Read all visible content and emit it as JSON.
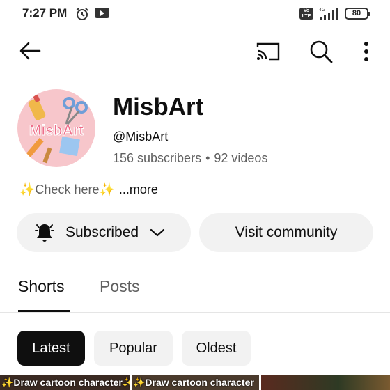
{
  "status_bar": {
    "time": "7:27 PM",
    "network": "4G",
    "volte": "Vo LTE",
    "battery": "80",
    "icons": [
      "alarm-icon",
      "youtube-notification-icon",
      "volte-icon",
      "signal-icon",
      "battery-icon"
    ]
  },
  "top_bar": {
    "icons": [
      "back-arrow-icon",
      "cast-icon",
      "search-icon",
      "more-vert-icon"
    ]
  },
  "channel": {
    "name": "MisbArt",
    "handle": "@MisbArt",
    "subscribers": "156 subscribers",
    "separator": "•",
    "videos": "92 videos",
    "avatar_text": "MisbArt",
    "description": {
      "sparkle": "✨",
      "text": "Check here",
      "more": "...more"
    }
  },
  "actions": {
    "subscribe_label": "Subscribed",
    "community_label": "Visit community"
  },
  "tabs": [
    {
      "label": "Shorts",
      "selected": true
    },
    {
      "label": "Posts",
      "selected": false
    }
  ],
  "chips": [
    {
      "label": "Latest",
      "selected": true
    },
    {
      "label": "Popular",
      "selected": false
    },
    {
      "label": "Oldest",
      "selected": false
    }
  ],
  "shorts": [
    {
      "title": "✨Draw cartoon character✨"
    },
    {
      "title": "✨Draw cartoon character"
    }
  ],
  "colors": {
    "text_primary": "#0f0f0f",
    "text_secondary": "#606060",
    "chip_bg": "#f2f2f2",
    "chip_selected_bg": "#0f0f0f",
    "avatar_bg": "#f7c6cb",
    "sparkle": "#e8c33a"
  }
}
